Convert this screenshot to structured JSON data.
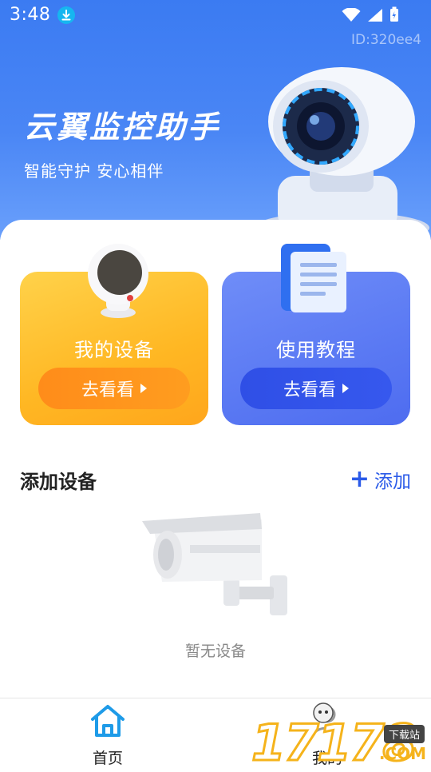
{
  "statusbar": {
    "time": "3:48"
  },
  "header": {
    "device_id": "ID:320ee4",
    "title": "云翼监控助手",
    "subtitle": "智能守护 安心相伴"
  },
  "cards": [
    {
      "title": "我的设备",
      "button": "去看看"
    },
    {
      "title": "使用教程",
      "button": "去看看"
    }
  ],
  "section": {
    "title": "添加设备",
    "add_label": "添加",
    "empty_text": "暂无设备"
  },
  "tabs": [
    {
      "label": "首页"
    },
    {
      "label": "我的"
    }
  ],
  "watermark": {
    "digits": "17178",
    "tag": "下载站",
    "suffix": ".COM"
  },
  "colors": {
    "hero": "#3b7bf2",
    "accent": "#2a5ae8",
    "orange": "#ffb723",
    "blue": "#5a79f3",
    "home_icon": "#1e9be8"
  }
}
